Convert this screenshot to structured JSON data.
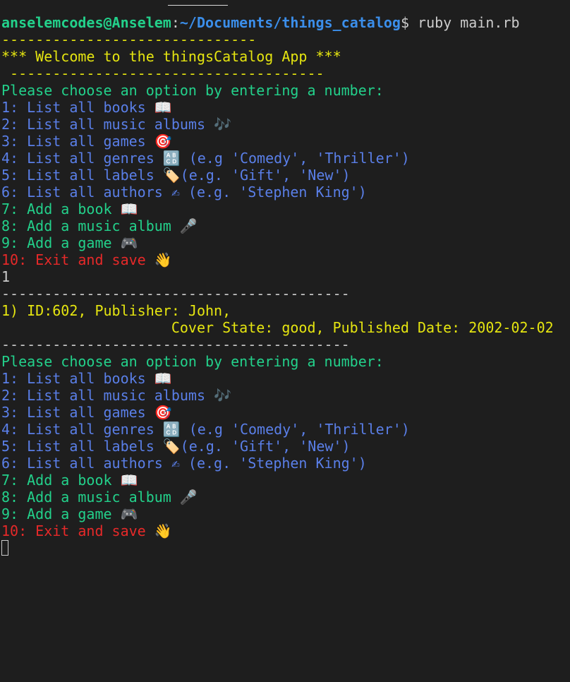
{
  "prompt": {
    "user": "anselemcodes@Anselem",
    "separator": ":",
    "path": "~/Documents/things_catalog",
    "symbol": "$ ",
    "command": "ruby main.rb"
  },
  "rule_top": "------------------------------",
  "welcome": "*** Welcome to the thingsCatalog App ***",
  "rule_welcome": " -------------------------------------",
  "menu": {
    "header": "Please choose an option by entering a number:",
    "items": [
      {
        "text": "1: List all books 📖",
        "kind": "list"
      },
      {
        "text": "2: List all music albums 🎶",
        "kind": "list"
      },
      {
        "text": "3: List all games 🎯",
        "kind": "list"
      },
      {
        "text": "4: List all genres 🔠 (e.g 'Comedy', 'Thriller')",
        "kind": "list"
      },
      {
        "text": "5: List all labels 🏷️(e.g. 'Gift', 'New')",
        "kind": "list"
      },
      {
        "text": "6: List all authors ✍ (e.g. 'Stephen King')",
        "kind": "list"
      },
      {
        "text": "7: Add a book 📖",
        "kind": "add"
      },
      {
        "text": "8: Add a music album 🎤",
        "kind": "add"
      },
      {
        "text": "9: Add a game 🎮",
        "kind": "add"
      },
      {
        "text": "10: Exit and save 👋",
        "kind": "exit"
      }
    ]
  },
  "user_input": "1",
  "rule_result": "-----------------------------------------",
  "result": {
    "line1": "1) ID:602, Publisher: John,",
    "line2": "                    Cover State: good, Published Date: 2002-02-02"
  },
  "colors": {
    "background": "#1e1e1e",
    "user_green": "#23d18b",
    "path_blue": "#3b8eea",
    "yellow": "#e5e510",
    "menu_blue": "#5a7fe8",
    "exit_red": "#e62929",
    "text": "#cccccc"
  }
}
